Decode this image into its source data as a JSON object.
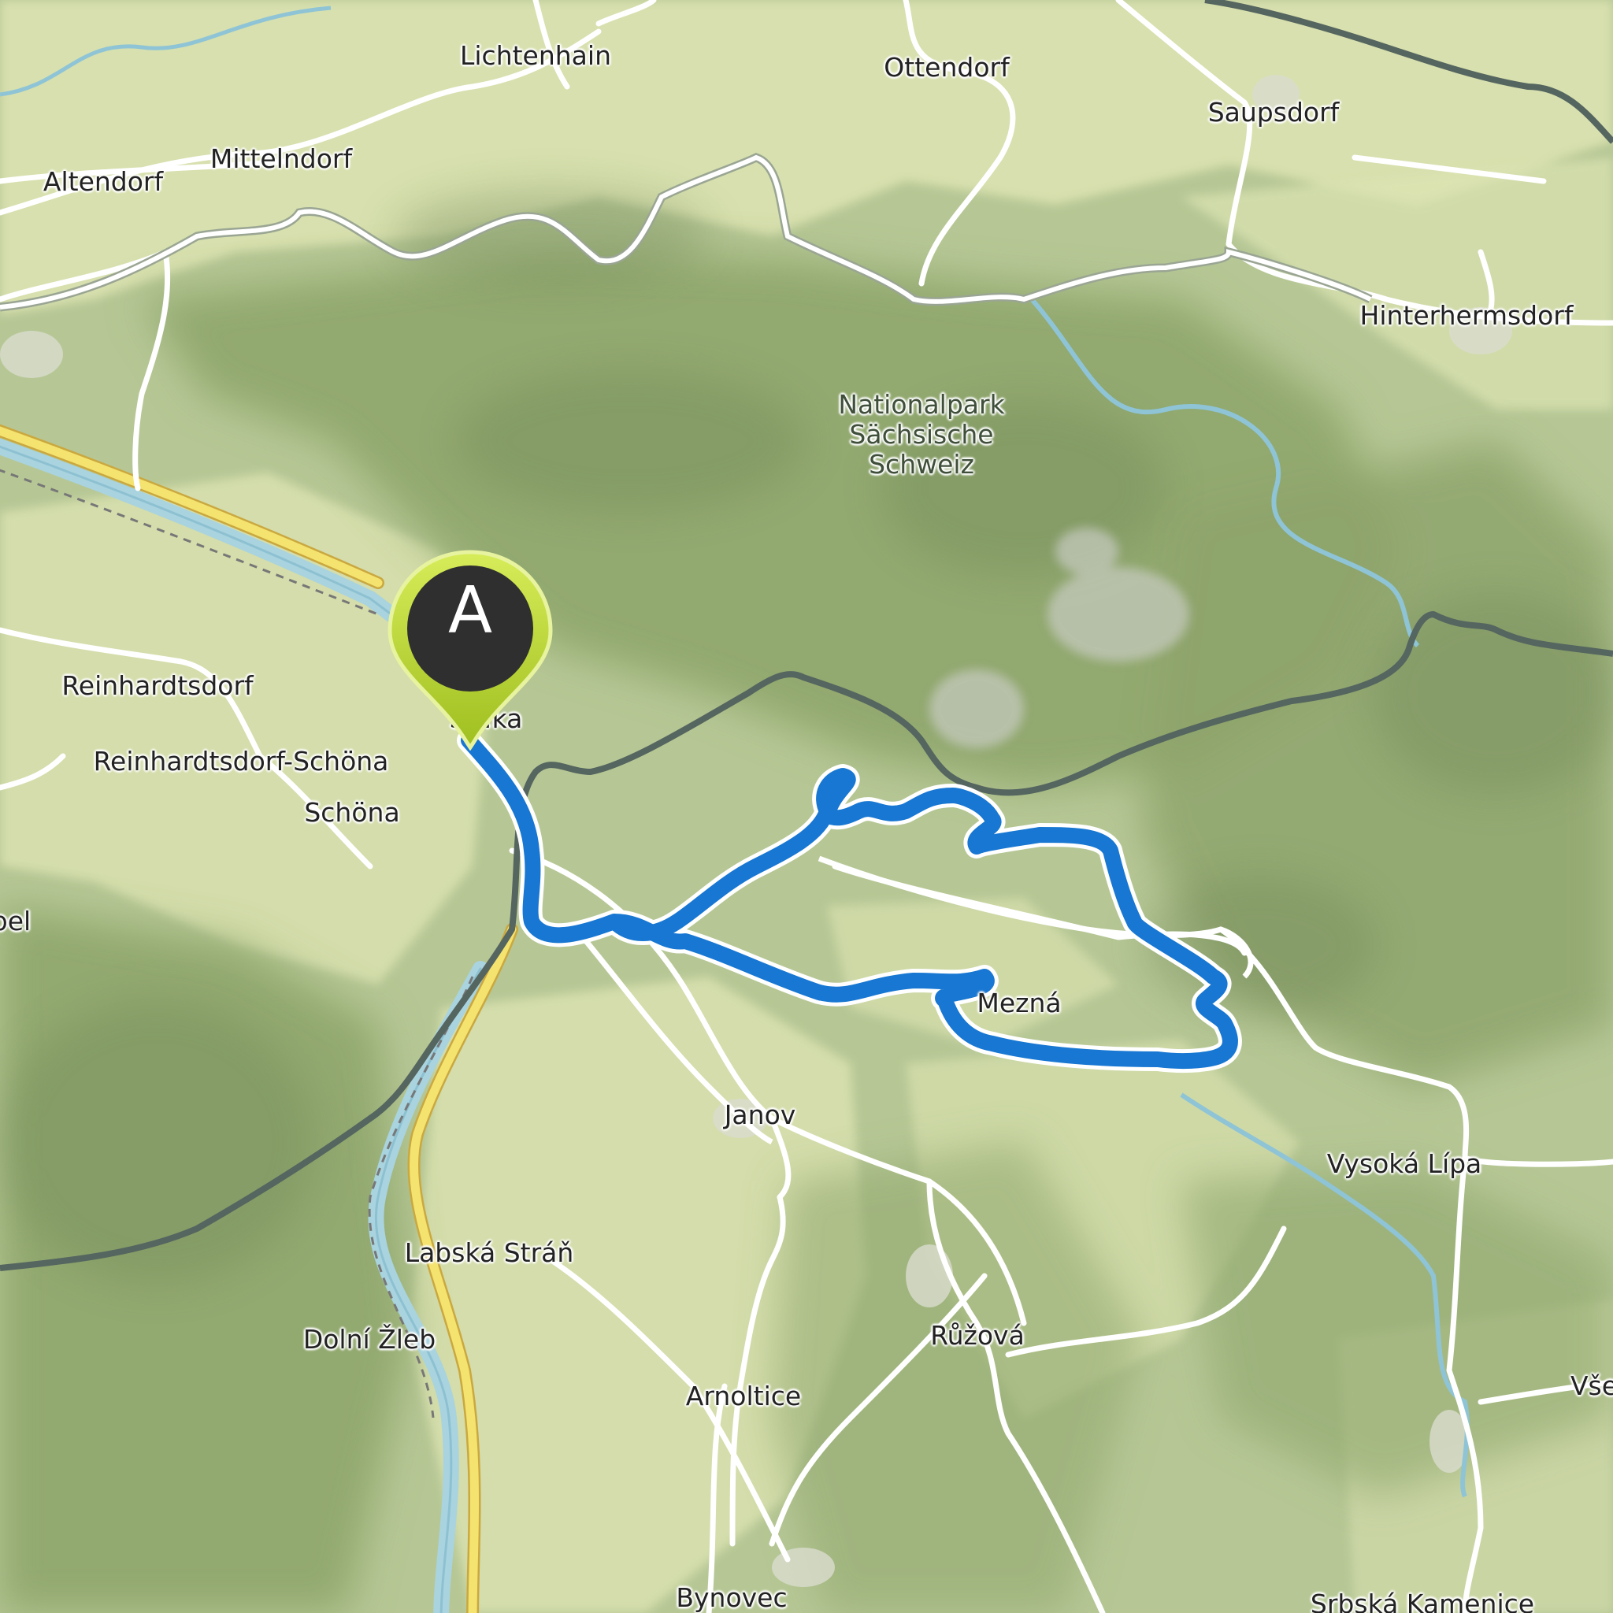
{
  "map": {
    "marker": {
      "letter": "A"
    },
    "places": {
      "lichtenhain": "Lichtenhain",
      "ottendorf": "Ottendorf",
      "saupsdorf": "Saupsdorf",
      "altendorf": "Altendorf",
      "mittelndorf": "Mittelndorf",
      "hinterhermsdorf": "Hinterhermsdorf",
      "nationalpark": "Nationalpark\nSächsische\nSchweiz",
      "reinhardtsdorf": "Reinhardtsdorf",
      "reinhardtsdorf_schona": "Reinhardtsdorf-Schöna",
      "schona": "Schöna",
      "hrensko_partial": "S…ka",
      "partial_left": "bel",
      "mezna": "Mezná",
      "janov": "Janov",
      "vysoka_lipa": "Vysoká Lípa",
      "labska_stran": "Labská Stráň",
      "dolni_zleb": "Dolní Žleb",
      "ruzova": "Růžová",
      "arnoltice": "Arnoltice",
      "bynovec": "Bynovec",
      "srbska_kamenice": "Srbská Kamenice",
      "vse_partial": "Vše"
    },
    "colors": {
      "route": "#1877d2",
      "river": "#a9d3df",
      "border": "#5b6b66",
      "main_road": "#f4e36f",
      "forest": "#9fb47d",
      "meadow": "#dfe5b5",
      "marker_ring": "#b9d52d",
      "marker_fill": "#2f2f2f"
    }
  }
}
